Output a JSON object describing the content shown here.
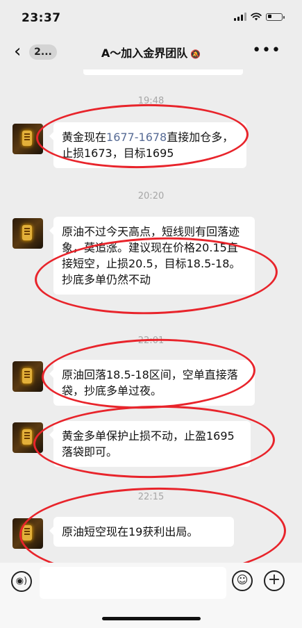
{
  "status_bar": {
    "time": "23:37",
    "battery_level": 0.3
  },
  "nav": {
    "back_label": "2...",
    "title": "A～加入金界团队",
    "mute_icon": "bell-slash-icon",
    "more_icon": "more-dots-icon"
  },
  "messages": [
    {
      "time": "19:48",
      "parts": [
        {
          "text": "黄金现在"
        },
        {
          "text": "1677-1678",
          "link": true
        },
        {
          "text": "直接加仓多，止损1673，目标1695"
        }
      ]
    },
    {
      "time": "20:20",
      "parts": [
        {
          "text": "原油不过今天高点，短线则有回落迹象，莫追涨。建议现在价格20.15直接短空，止损20.5，目标18.5-18。抄底多单仍然不动"
        }
      ]
    },
    {
      "time": "22:01",
      "parts": [
        {
          "text": "原油回落18.5-18区间，空单直接落袋，抄底多单过夜。"
        }
      ]
    },
    {
      "time": "",
      "parts": [
        {
          "text": "黄金多单保护止损不动，止盈1695落袋即可。"
        }
      ]
    },
    {
      "time": "22:15",
      "parts": [
        {
          "text": "原油短空现在19获利出局。"
        }
      ]
    }
  ],
  "input_bar": {
    "voice_icon": "voice-icon",
    "emoji_icon": "emoji-icon",
    "plus_icon": "plus-icon",
    "input_value": ""
  },
  "colors": {
    "annotation": "#e8242b",
    "link": "#576b95",
    "background": "#ededed"
  }
}
